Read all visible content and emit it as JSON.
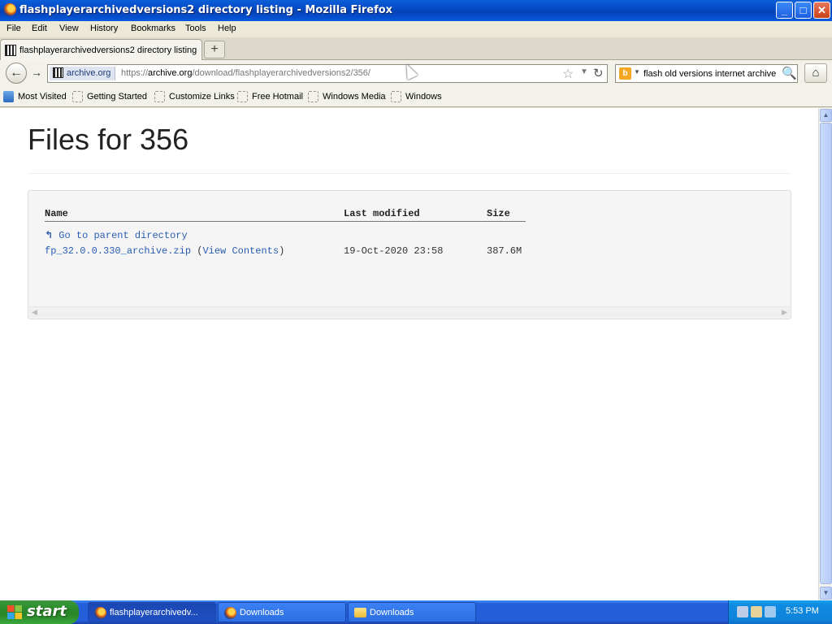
{
  "window": {
    "title": "flashplayerarchivedversions2 directory listing - Mozilla Firefox",
    "minimize": "_",
    "maximize": "□",
    "close": "✕"
  },
  "menu": [
    "File",
    "Edit",
    "View",
    "History",
    "Bookmarks",
    "Tools",
    "Help"
  ],
  "tab": {
    "label": "flashplayerarchivedversions2 directory listing",
    "new_tab": "+"
  },
  "nav": {
    "back": "←",
    "forward": "→",
    "site_identity": "archive.org",
    "url_prefix": "https://",
    "url_host": "archive.org",
    "url_path": "/download/flashplayerarchivedversions2/356/",
    "bookmark_star": "☆",
    "dropdown": "▼",
    "reload": "↻",
    "search_text": "flash old versions internet archive",
    "search_go": "🔍",
    "home": "⌂"
  },
  "bookmarks": [
    "Most Visited",
    "Getting Started",
    "Customize Links",
    "Free Hotmail",
    "Windows Media",
    "Windows"
  ],
  "page": {
    "title": "Files for 356",
    "columns": {
      "name": "Name",
      "modified": "Last modified",
      "size": "Size"
    },
    "parent_link": "Go to parent directory",
    "parent_arrow": "↰",
    "files": [
      {
        "name": "fp_32.0.0.330_archive.zip",
        "view_open": " (",
        "view_contents": "View Contents",
        "view_close": ")",
        "modified": "19-Oct-2020 23:58",
        "size": "387.6M"
      }
    ]
  },
  "scrollbar": {
    "up": "▲",
    "down": "▼",
    "left": "◀",
    "right": "▶"
  },
  "taskbar": {
    "start": "start",
    "tasks": [
      {
        "label": "flashplayerarchivedv...",
        "icon": "firefox-icon",
        "active": true
      },
      {
        "label": "Downloads",
        "icon": "firefox-icon",
        "active": false
      },
      {
        "label": "Downloads",
        "icon": "folder-icon",
        "active": false
      }
    ],
    "clock": "5:53 PM"
  }
}
